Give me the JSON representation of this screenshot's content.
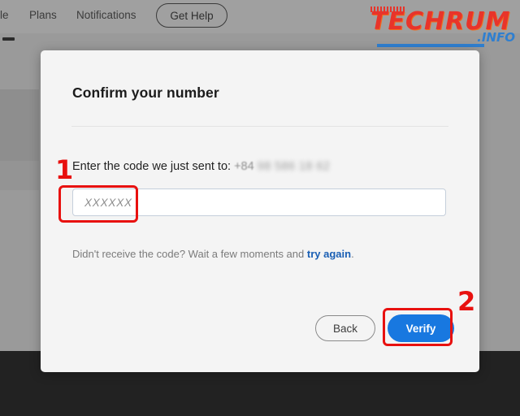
{
  "background": {
    "nav": {
      "truncated_item": "le",
      "items": [
        {
          "label": "Plans"
        },
        {
          "label": "Notifications"
        }
      ],
      "get_help_label": "Get Help"
    }
  },
  "watermark": {
    "brand": "TECHRUM",
    "suffix": ".INFO",
    "brand_color": "#e8342a",
    "suffix_color": "#2f7fd0"
  },
  "dialog": {
    "title": "Confirm your number",
    "prompt_label": "Enter the code we just sent to:",
    "phone_prefix": "+84",
    "phone_masked": "98 586 18 62",
    "code_input": {
      "value": "",
      "placeholder": "XXXXXX"
    },
    "resend": {
      "text": "Didn't receive the code? Wait a few moments and",
      "link_label": "try again",
      "period": "."
    },
    "buttons": {
      "back_label": "Back",
      "verify_label": "Verify",
      "verify_color": "#1878e0"
    }
  },
  "annotations": {
    "color": "#e8110f",
    "markers": [
      {
        "label": "1",
        "target": "code-input"
      },
      {
        "label": "2",
        "target": "verify-button"
      }
    ]
  }
}
